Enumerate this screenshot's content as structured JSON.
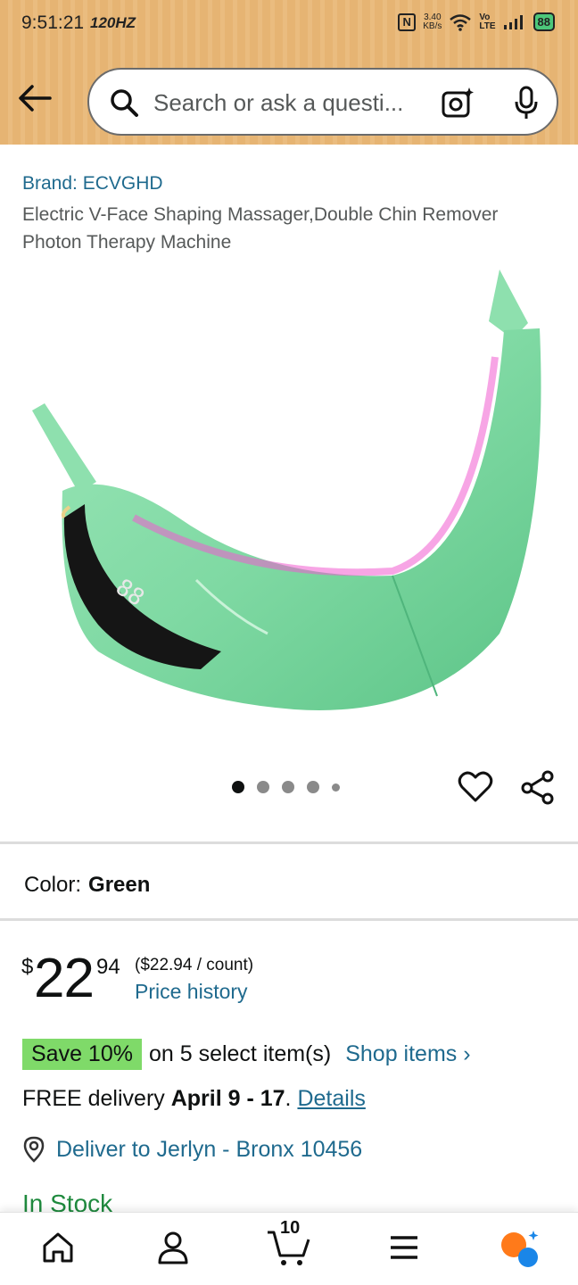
{
  "status_bar": {
    "time": "9:51:21",
    "refresh": "120HZ",
    "nfc": "N",
    "net_speed": "3.40",
    "net_unit": "KB/s",
    "volte_top": "Vo",
    "volte_bottom": "LTE",
    "battery": "88"
  },
  "search": {
    "placeholder": "Search or ask a questi..."
  },
  "product": {
    "brand": "Brand: ECVGHD",
    "title": "Electric V-Face Shaping Massager,Double Chin Remover Photon Therapy Machine",
    "image_colors": {
      "body": "#7fd9a3",
      "shade": "#5cc487",
      "accent": "#f05bd0"
    },
    "carousel": {
      "count": 5,
      "active_index": 0
    }
  },
  "color": {
    "label": "Color:",
    "value": "Green"
  },
  "price": {
    "currency": "$",
    "whole": "22",
    "fraction": "94",
    "unit_price": "($22.94 / count)",
    "history_link": "Price history"
  },
  "promo": {
    "badge": "Save 10%",
    "text": "on 5 select item(s)",
    "link": "Shop items ›"
  },
  "delivery": {
    "prefix": "FREE delivery",
    "dates": "April 9 - 17",
    "suffix": ".",
    "link": "Details"
  },
  "location": {
    "text": "Deliver to Jerlyn - Bronx 10456"
  },
  "stock": {
    "text": "In Stock"
  },
  "bottom_nav": {
    "cart_count": "10"
  },
  "colors": {
    "link": "#1f6a8e",
    "save_badge": "#7fda69",
    "header": "#e6b473",
    "in_stock": "#1f8a3e"
  }
}
